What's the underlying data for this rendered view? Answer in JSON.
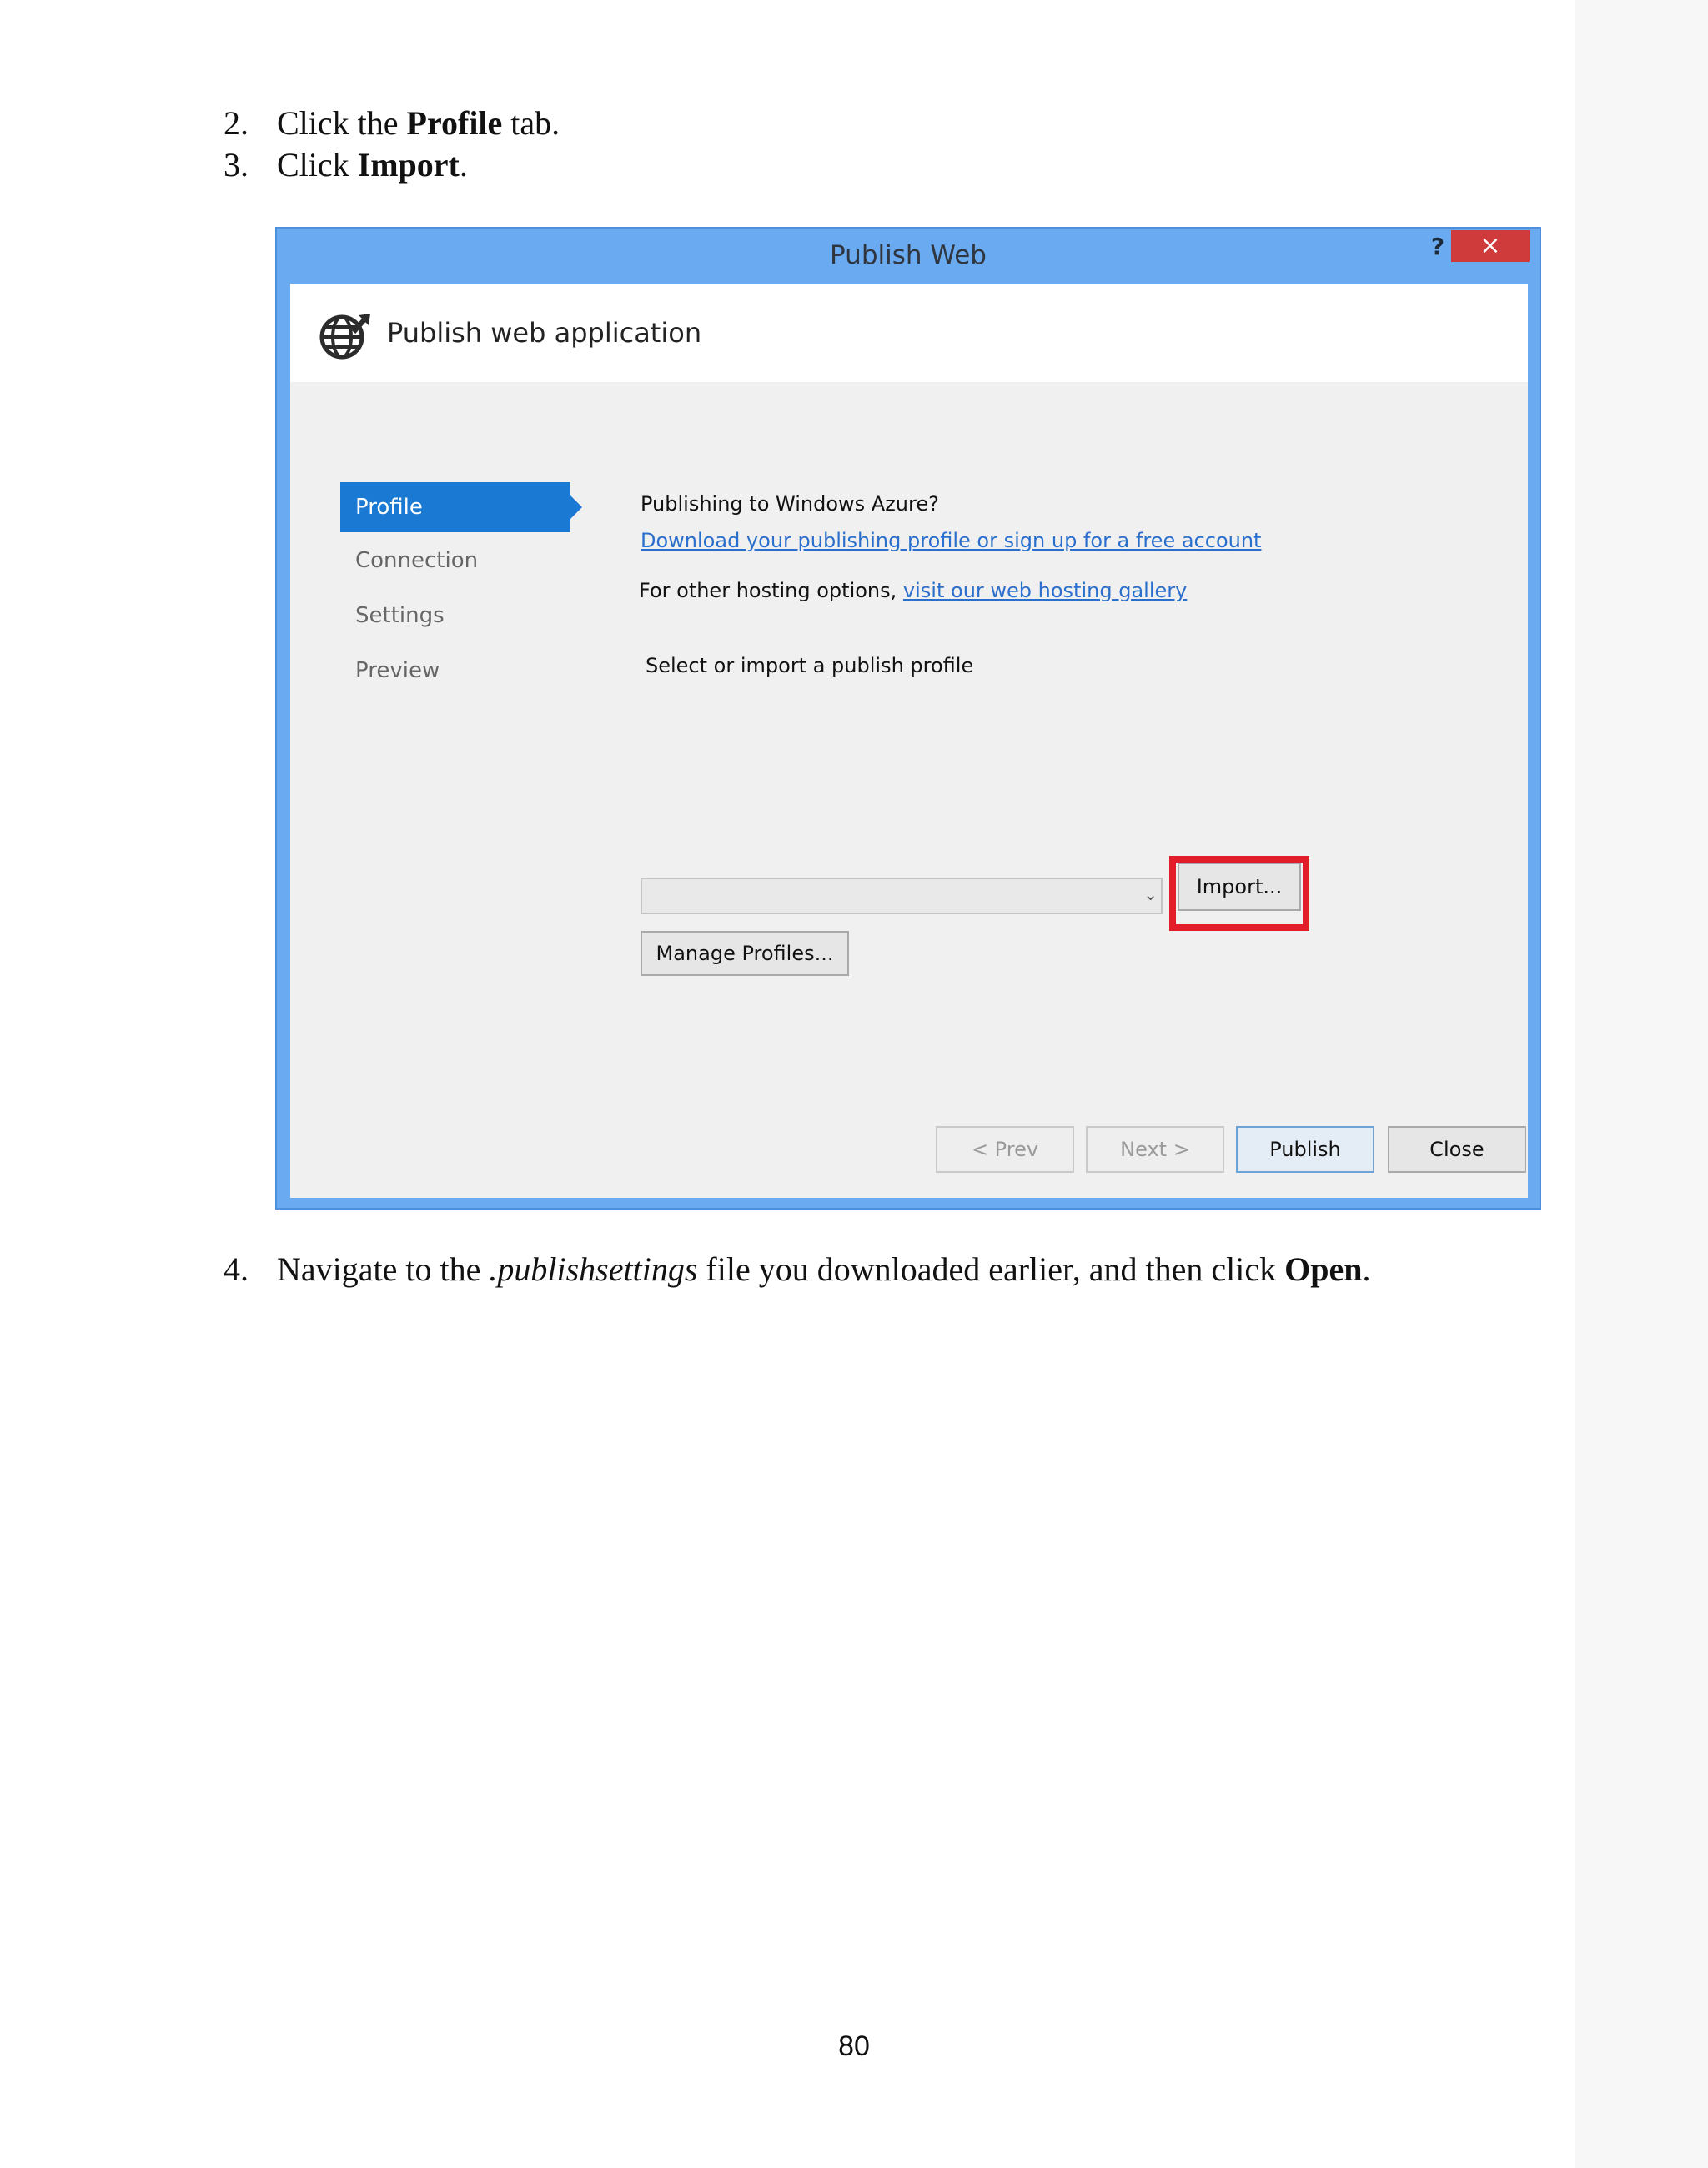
{
  "steps": [
    {
      "num": "2.",
      "pre": "Click the ",
      "bold": "Profile",
      "post": " tab."
    },
    {
      "num": "3.",
      "pre": "Click ",
      "bold": "Import",
      "post": "."
    },
    {
      "num": "4.",
      "pre": "Navigate to the ",
      "italic": ".publishsettings",
      "mid": " file you downloaded earlier, and then click ",
      "bold": "Open",
      "post": "."
    }
  ],
  "dialog": {
    "title": "Publish Web",
    "help_label": "?",
    "close_label": "×",
    "header_title": "Publish web application",
    "nav": [
      "Profile",
      "Connection",
      "Settings",
      "Preview"
    ],
    "azure_question": "Publishing to Windows Azure?",
    "download_link": "Download your publishing profile or sign up for a free account",
    "other_hosting": "For other hosting options,",
    "gallery_link": "visit our web hosting gallery",
    "select_label": "Select or import a publish profile",
    "dropdown_value": "",
    "import_button": "Import...",
    "manage_button": "Manage Profiles...",
    "prev_button": "< Prev",
    "next_button": "Next >",
    "publish_button": "Publish",
    "close_button": "Close"
  },
  "colors": {
    "highlight": "#e21d2a",
    "title_bar": "#6aaaf0",
    "active_tab": "#1a7ad3",
    "link": "#2a6fcc"
  },
  "page_number": "80"
}
